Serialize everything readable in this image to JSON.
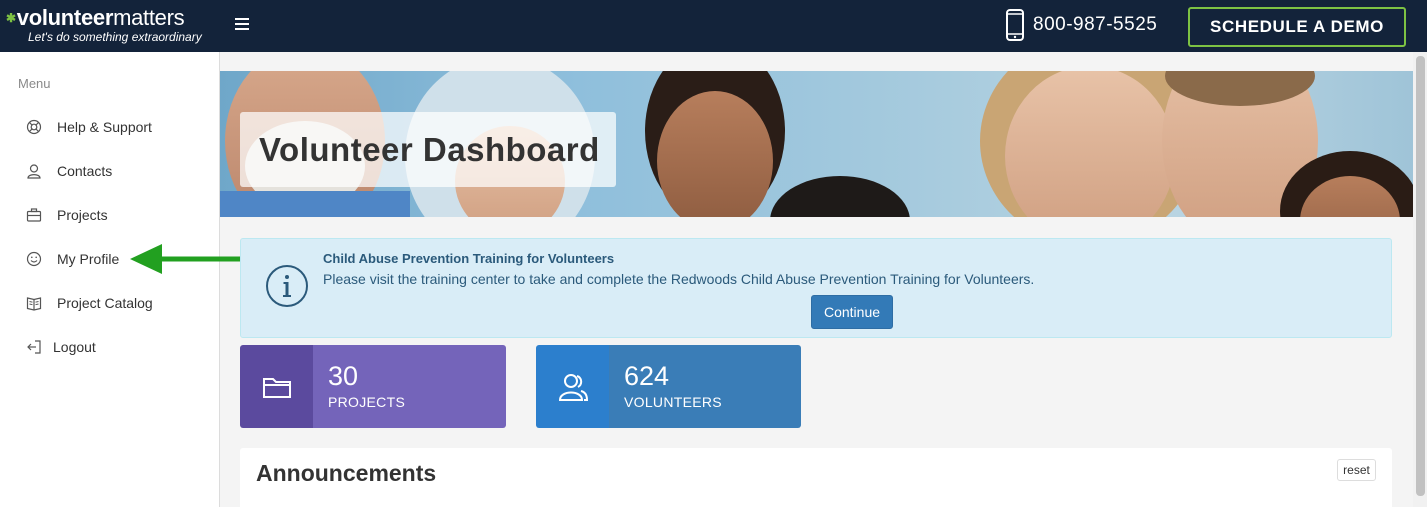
{
  "header": {
    "logo_bold": "volunteer",
    "logo_light": "matters",
    "tagline": "Let's do something extraordinary",
    "phone": "800-987-5525",
    "demo_label": "SCHEDULE A DEMO"
  },
  "sidebar": {
    "heading": "Menu",
    "items": [
      {
        "label": "Help & Support",
        "icon": "lifebuoy-icon"
      },
      {
        "label": "Contacts",
        "icon": "contact-icon"
      },
      {
        "label": "Projects",
        "icon": "briefcase-icon"
      },
      {
        "label": "My Profile",
        "icon": "smiley-icon"
      },
      {
        "label": "Project Catalog",
        "icon": "book-icon"
      },
      {
        "label": "Logout",
        "icon": "logout-icon"
      }
    ]
  },
  "hero": {
    "title": "Volunteer Dashboard"
  },
  "alert": {
    "title": "Child Abuse Prevention Training for Volunteers",
    "text": "Please visit the training center to take and complete the Redwoods Child Abuse Prevention Training for Volunteers.",
    "button": "Continue"
  },
  "stats": [
    {
      "value": "30",
      "label": "PROJECTS",
      "icon": "folder-icon"
    },
    {
      "value": "624",
      "label": "VOLUNTEERS",
      "icon": "users-icon"
    }
  ],
  "announcements": {
    "title": "Announcements",
    "reset": "reset"
  },
  "colors": {
    "topbar": "#13233a",
    "accent_green": "#7dc243",
    "projects_tile": "#7464ba",
    "volunteers_tile": "#3a7db7",
    "alert_bg": "#d9edf7"
  }
}
